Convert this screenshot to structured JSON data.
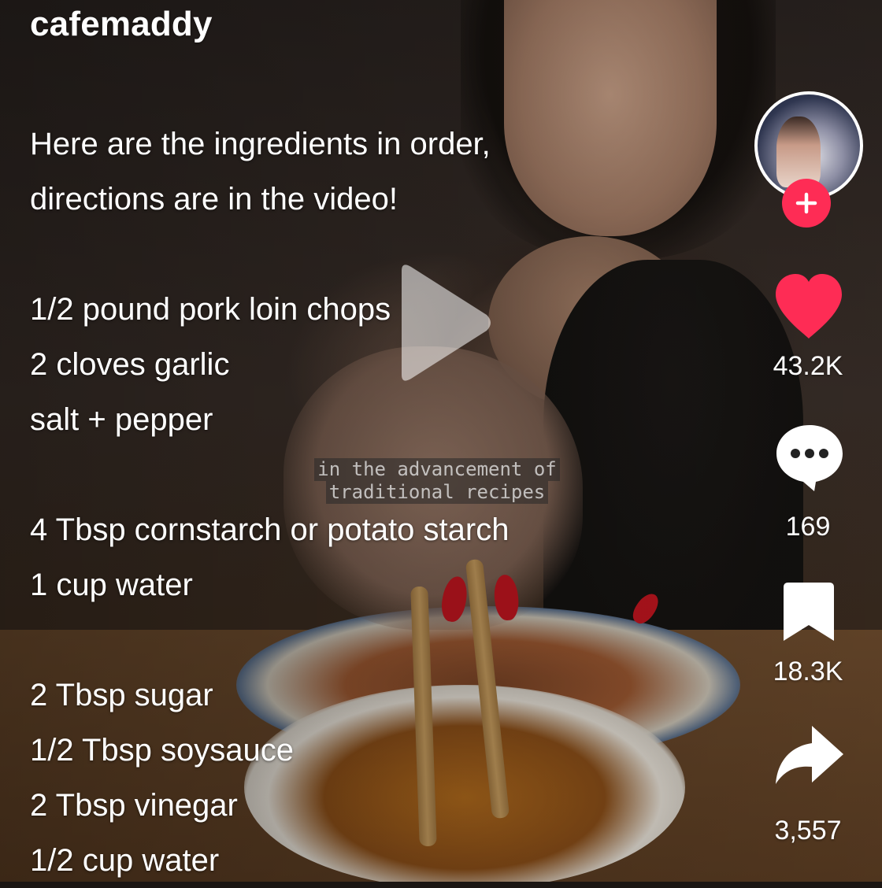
{
  "profile": {
    "username": "cafemaddy"
  },
  "caption": {
    "lines": [
      "Here are the ingredients in order,",
      "directions are in the video!",
      "",
      "1/2 pound pork loin chops",
      "2 cloves garlic",
      "salt + pepper",
      "",
      "4 Tbsp cornstarch or potato starch",
      "1 cup water",
      "",
      "2 Tbsp sugar",
      "1/2 Tbsp soysauce",
      "2 Tbsp vinegar",
      "1/2 cup water"
    ]
  },
  "video": {
    "subtitle_lines": [
      "in the advancement of",
      "traditional recipes"
    ],
    "state": "paused"
  },
  "actions": {
    "likes": "43.2K",
    "comments": "169",
    "saves": "18.3K",
    "shares": "3,557"
  },
  "colors": {
    "like_active": "#fe2c55",
    "follow_badge": "#fe2c55",
    "text": "#ffffff"
  },
  "icons": {
    "play": "play-icon",
    "follow": "plus-icon",
    "like": "heart-icon",
    "comment": "comment-icon",
    "save": "bookmark-icon",
    "share": "share-arrow-icon"
  }
}
